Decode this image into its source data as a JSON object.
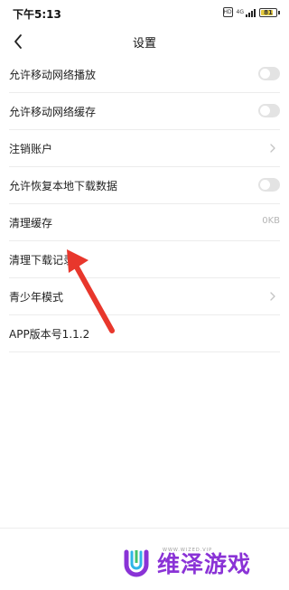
{
  "status_bar": {
    "time": "下午5:13",
    "hd_label": "HD",
    "network_label": "4G",
    "battery_percent": "81",
    "battery_level": 0.81
  },
  "header": {
    "back_icon": "chevron-left-icon",
    "title": "设置"
  },
  "settings": {
    "mobile_play": {
      "label": "允许移动网络播放",
      "enabled": false
    },
    "mobile_cache": {
      "label": "允许移动网络缓存",
      "enabled": false
    },
    "cancel_account": {
      "label": "注销账户"
    },
    "restore_downloads": {
      "label": "允许恢复本地下载数据",
      "enabled": false
    },
    "clear_cache": {
      "label": "清理缓存",
      "value": "0KB"
    },
    "clear_download_history": {
      "label": "清理下载记录"
    },
    "teen_mode": {
      "label": "青少年模式"
    },
    "app_version": {
      "label": "APP版本号1.1.2"
    }
  },
  "watermark": {
    "text": "维泽游戏",
    "subtext": "WWW.WIZED.VIP"
  },
  "colors": {
    "toggle_off": "#e3e3e3",
    "annotation_arrow": "#e8372c",
    "watermark": "#8a33d6"
  }
}
